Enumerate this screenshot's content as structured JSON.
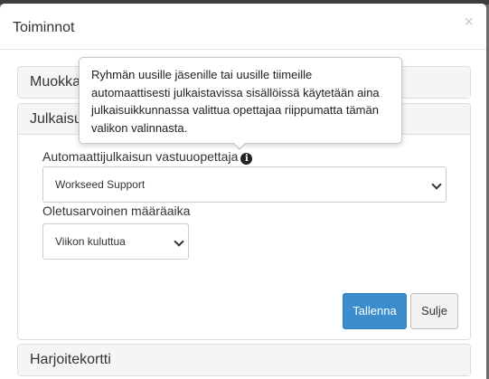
{
  "modal": {
    "title": "Toiminnot",
    "close_symbol": "×"
  },
  "panels": {
    "edit": {
      "title": "Muokkaa"
    },
    "publish": {
      "title": "Julkaisu",
      "responsible_teacher_label": "Automaattijulkaisun vastuuopettaja",
      "responsible_teacher_value": "Workseed Support",
      "default_deadline_label": "Oletusarvoinen määräaika",
      "default_deadline_value": "Viikon kuluttua",
      "save_label": "Tallenna",
      "close_label": "Sulje"
    },
    "exercise_card": {
      "title": "Harjoitekortti"
    }
  },
  "tooltip": {
    "text": "Ryhmän uusille jäsenille tai uusille tiimeille automaattisesti julkaistavissa sisällöissä käytetään aina julkaisuikkunnassa valittua opettajaa riippumatta tämän valikon valinnasta."
  },
  "icons": {
    "info": "info-circle-icon",
    "dropdown": "chevron-down-icon"
  },
  "colors": {
    "primary_button": "#3c8dce",
    "backdrop": "#6b6b6b"
  }
}
